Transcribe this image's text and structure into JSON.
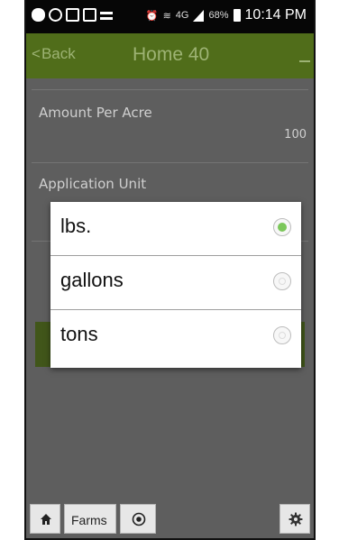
{
  "status_bar": {
    "network_label": "4G",
    "battery_label": "68%",
    "time": "10:14 PM"
  },
  "header": {
    "back_label": "Back",
    "title": "Home 40"
  },
  "form": {
    "amount_label": "Amount Per Acre",
    "amount_value": "100",
    "unit_label": "Application Unit"
  },
  "dialog": {
    "options": [
      {
        "label": "lbs.",
        "selected": true
      },
      {
        "label": "gallons",
        "selected": false
      },
      {
        "label": "tons",
        "selected": false
      }
    ]
  },
  "toolbar": {
    "farms_label": "Farms"
  },
  "colors": {
    "header_green": "#506d1a",
    "accent_green": "#7bc75a"
  }
}
